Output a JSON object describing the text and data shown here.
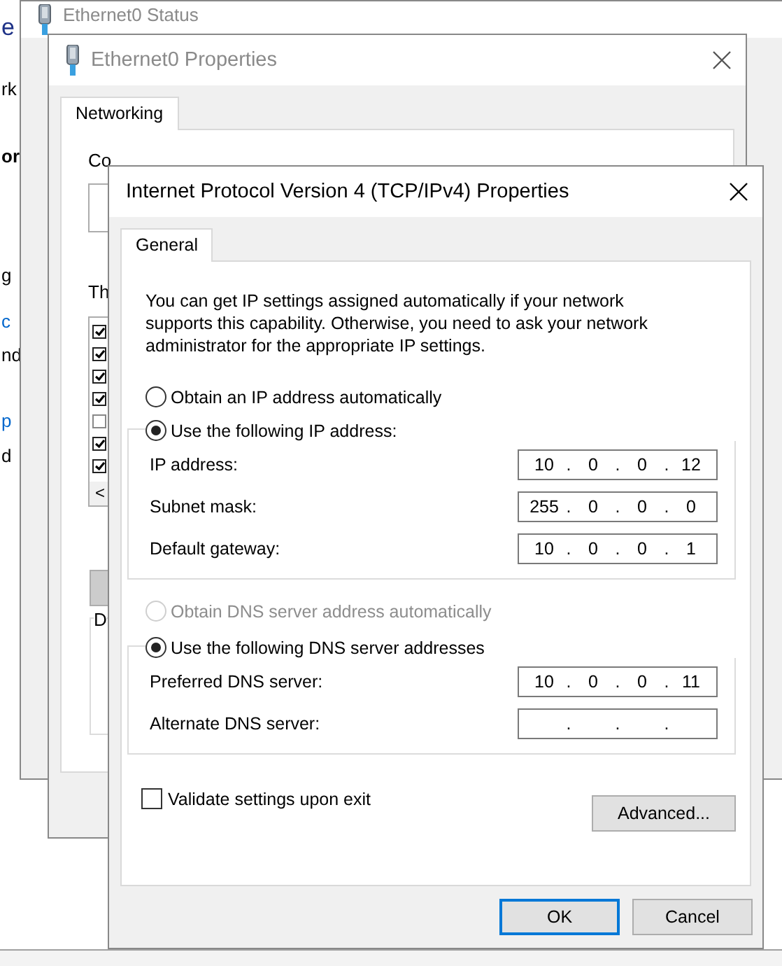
{
  "background_fragments": [
    {
      "text": "e",
      "kind": "heading"
    },
    {
      "text": "rk",
      "kind": "plain"
    },
    {
      "text": "or",
      "kind": "bold"
    },
    {
      "text": "g",
      "kind": "plain"
    },
    {
      "text": "c",
      "kind": "link"
    },
    {
      "text": "nd",
      "kind": "plain"
    },
    {
      "text": "p",
      "kind": "link"
    },
    {
      "text": "d",
      "kind": "plain"
    }
  ],
  "status_window": {
    "title": "Ethernet0 Status"
  },
  "properties_window": {
    "title": "Ethernet0 Properties",
    "tabs": [
      {
        "label": "Networking",
        "selected": true
      }
    ],
    "connect_label": "Co",
    "items_label": "Th",
    "items": [
      {
        "checked": true
      },
      {
        "checked": true
      },
      {
        "checked": true
      },
      {
        "checked": true
      },
      {
        "checked": false
      },
      {
        "checked": true
      },
      {
        "checked": true
      }
    ],
    "scroll_arrow": "<",
    "description_label": "D"
  },
  "dialog": {
    "title": "Internet Protocol Version 4 (TCP/IPv4) Properties",
    "tabs": [
      {
        "label": "General",
        "selected": true
      }
    ],
    "intro": "You can get IP settings assigned automatically if your network supports this capability. Otherwise, you need to ask your network administrator for the appropriate IP settings.",
    "ip_auto": {
      "label": "Obtain an IP address automatically",
      "selected": false,
      "disabled": false
    },
    "ip_manual": {
      "label": "Use the following IP address:",
      "selected": true,
      "disabled": false
    },
    "ip_fields": [
      {
        "label": "IP address:",
        "octets": [
          "10",
          "0",
          "0",
          "12"
        ],
        "separators": [
          ".",
          ".",
          "."
        ]
      },
      {
        "label": "Subnet mask:",
        "octets": [
          "255",
          "0",
          "0",
          "0"
        ],
        "separators": [
          ".",
          ".",
          "."
        ]
      },
      {
        "label": "Default gateway:",
        "octets": [
          "10",
          "0",
          "0",
          "1"
        ],
        "separators": [
          ".",
          ".",
          "."
        ]
      }
    ],
    "dns_auto": {
      "label": "Obtain DNS server address automatically",
      "selected": false,
      "disabled": true
    },
    "dns_manual": {
      "label": "Use the following DNS server addresses",
      "selected": true,
      "disabled": false
    },
    "dns_fields": [
      {
        "label": "Preferred DNS server:",
        "octets": [
          "10",
          "0",
          "0",
          "11"
        ],
        "separators": [
          ".",
          ".",
          "."
        ]
      },
      {
        "label": "Alternate DNS server:",
        "separators": [
          ".",
          ".",
          "."
        ]
      }
    ],
    "validate": {
      "label": "Validate settings upon exit",
      "checked": false
    },
    "advanced_button": "Advanced...",
    "buttons": [
      {
        "label": "OK",
        "default": true
      },
      {
        "label": "Cancel",
        "default": false
      }
    ]
  }
}
